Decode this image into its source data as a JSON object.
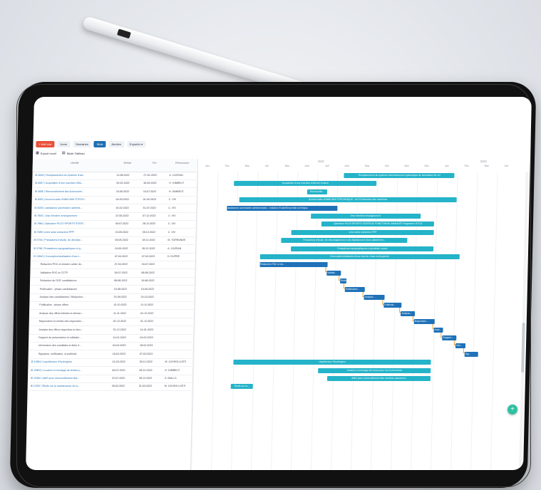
{
  "toolbar": {
    "add_label": "+ Add row",
    "views": [
      {
        "label": "Jours",
        "active": false
      },
      {
        "label": "Semaines",
        "active": false
      },
      {
        "label": "Mois",
        "active": true
      },
      {
        "label": "Années",
        "active": false
      }
    ],
    "export_menu": "Exporter ▾",
    "export_excel": "Export excel",
    "fullscreen": "Mode Tableau"
  },
  "columns": {
    "label": "Libellé",
    "start": "Début",
    "end": "Fin",
    "resource": "Ressource"
  },
  "timeline": {
    "years": [
      {
        "label": "2022"
      },
      {
        "label": "2023"
      }
    ],
    "months": [
      "Jan",
      "Fév",
      "Mar",
      "Avr",
      "Mai",
      "Juin",
      "Juil",
      "Aoû",
      "Sep",
      "Oct",
      "Nov",
      "Déc",
      "Jan",
      "Fév",
      "Mar",
      "Avr"
    ]
  },
  "rows": [
    {
      "label": "⊞ 0045 | Remplacement du système d'act...",
      "start": "11-08-2022",
      "end": "27-01-2023",
      "res": "A. CASSAN",
      "type": "parent"
    },
    {
      "label": "⊞ 0057 | Acquisition d'une machine d'éle...",
      "start": "26-02-2022",
      "end": "30-09-2022",
      "res": "H. GIMBEUT",
      "type": "parent"
    },
    {
      "label": "⊞ 0056 | Renouvellement des licences/m...",
      "start": "16-06-2022",
      "end": "16-07-2022",
      "res": "H. GIMBEUT",
      "type": "parent"
    },
    {
      "label": "⊞ 0053 | Accord-cadre d'AMO MULTITECH...",
      "start": "04-03-2022",
      "end": "01-02-2023",
      "res": "C. VIV",
      "type": "parent"
    },
    {
      "label": "⊞ 0033 | assistance automation adminis...",
      "start": "16-02-2022",
      "end": "31-07-2022",
      "res": "C. VIV",
      "type": "parent"
    },
    {
      "label": "⊞ 7926 | Jose fonction enseignement",
      "start": "22-06-2022",
      "end": "07-12-2022",
      "res": "C. VIV",
      "type": "parent"
    },
    {
      "label": "⊞ 7984 | Opération PCC3 SPORTS STATE...",
      "start": "09-07-2022",
      "end": "28-12-2022",
      "res": "C. VIV",
      "type": "parent"
    },
    {
      "label": "⊞ 7089 | zone solar extraction PPP",
      "start": "24-05-2022",
      "end": "28-12-2022",
      "res": "C. VIV",
      "type": "parent"
    },
    {
      "label": "⊞ 5794 | Prestations d'étude, de dévelop...",
      "start": "09-05-2022",
      "end": "18-11-2022",
      "res": "M. TORRANDE",
      "type": "parent"
    },
    {
      "label": "⊞ 5798 | Prestations topographiques et g...",
      "start": "24-05-2022",
      "end": "28-12-2022",
      "res": "A. CASSAN",
      "type": "parent"
    },
    {
      "label": "⊟ 12843 | Conception/réalisation d'une t...",
      "start": "07-04-2022",
      "end": "07-02-2023",
      "res": "H. DUPRE",
      "type": "parent"
    },
    {
      "label": "Rédaction PDC et dossier cahier de...",
      "start": "07-04-2022",
      "end": "18-07-2022",
      "res": "",
      "type": "child"
    },
    {
      "label": "Validation PDC et CCTP",
      "start": "18-07-2022",
      "end": "08-08-2022",
      "res": "",
      "type": "child"
    },
    {
      "label": "Rédaction du DCE candidatures",
      "start": "08-08-2022",
      "end": "16-08-2022",
      "res": "",
      "type": "child"
    },
    {
      "label": "Publication - phase candidatures",
      "start": "16-08-2022",
      "end": "15-09-2022",
      "res": "",
      "type": "child"
    },
    {
      "label": "Analyse des candidatures / Rédaction...",
      "start": "15-09-2022",
      "end": "15-10-2022",
      "res": "",
      "type": "child"
    },
    {
      "label": "Publication - phase offres",
      "start": "15-10-2022",
      "end": "11-11-2022",
      "res": "",
      "type": "child"
    },
    {
      "label": "Analyse des offres initiales et deman...",
      "start": "11-11-2022",
      "end": "01-12-2022",
      "res": "",
      "type": "child"
    },
    {
      "label": "Négociation et remise des négociatio...",
      "start": "01-12-2022",
      "end": "31-12-2022",
      "res": "",
      "type": "child"
    },
    {
      "label": "Analyse des offres négociées et deci...",
      "start": "31-12-2022",
      "end": "14-01-2023",
      "res": "",
      "type": "child"
    },
    {
      "label": "Rapport de présentation et validatio...",
      "start": "14-01-2023",
      "end": "04-02-2023",
      "res": "",
      "type": "child"
    },
    {
      "label": "Information des candidats et délai d...",
      "start": "04-02-2023",
      "end": "18-02-2023",
      "res": "",
      "type": "child"
    },
    {
      "label": "Signature, notification, et publicité",
      "start": "18-02-2023",
      "end": "07-03-2023",
      "res": "",
      "type": "child"
    },
    {
      "label": "⊞ 12844 | Liquéfacteur d'hydrogène",
      "start": "01-03-2022",
      "end": "28-12-2022",
      "res": "M. CAYROU-OSTI",
      "type": "parent"
    },
    {
      "label": "⊞ 12853 | Location et montage de tentes p...",
      "start": "09-07-2022",
      "end": "28-12-2022",
      "res": "H. GIMBEUT",
      "type": "parent"
    },
    {
      "label": "⊞ 12902 | AMO pour renouvellement des...",
      "start": "22-07-2022",
      "end": "28-12-2022",
      "res": "S. BIALLS",
      "type": "parent"
    },
    {
      "label": "⊞ 12937 | Étude sur la maintenance de la...",
      "start": "28-02-2022",
      "end": "31-03-2022",
      "res": "M. CAYROU-OSTI",
      "type": "parent"
    }
  ],
  "bars": [
    {
      "label": "Remplacement du système d'actionnement hydraulique du simulateur de vol",
      "color": "teal"
    },
    {
      "label": "Acquisition d'une machine d'électro érosion",
      "color": "teal"
    },
    {
      "label": "Renouvella...",
      "color": "teal"
    },
    {
      "label": "Accord-cadre d'AMO MULTITECHNIQUE - lot 3 Relocation des machines",
      "color": "teal"
    },
    {
      "label": "assistance automation administrative - Initiative Etude/Ensemble technique",
      "color": "blue"
    },
    {
      "label": "Jose fonction enseignement",
      "color": "teal"
    },
    {
      "label": "Opération PCC3 SPORTS STATEGIC FONCTIONAL MANAGE Programme STCO",
      "color": "teal"
    },
    {
      "label": "zone solar extraction PPP",
      "color": "teal"
    },
    {
      "label": "Prestations d'étude, de développement et de déploiement d'une plateforme...",
      "color": "teal"
    },
    {
      "label": "Prestations topographiques et géodésie export",
      "color": "teal"
    },
    {
      "label": "Conception/réalisation d'une tour de chute multi-gravité",
      "color": "teal"
    },
    {
      "label": "Rédaction PDC et do...",
      "color": "blue"
    },
    {
      "label": "Validat...",
      "color": "blue"
    },
    {
      "label": "Rédac...",
      "color": "blue"
    },
    {
      "label": "Publication...",
      "color": "blue"
    },
    {
      "label": "Analyse ...",
      "color": "blue"
    },
    {
      "label": "Publicati...",
      "color": "blue"
    },
    {
      "label": "Analyse...",
      "color": "blue"
    },
    {
      "label": "Négociatio...",
      "color": "blue"
    },
    {
      "label": "Anal...",
      "color": "blue"
    },
    {
      "label": "Rapport...",
      "color": "blue"
    },
    {
      "label": "Info...",
      "color": "blue"
    },
    {
      "label": "Sig...",
      "color": "blue"
    },
    {
      "label": "Liquéfacteur d'hydrogène",
      "color": "teal"
    },
    {
      "label": "location et montage de tentes pour les événements",
      "color": "teal"
    },
    {
      "label": "AMO pour renouvellement des marchés assurance",
      "color": "teal"
    },
    {
      "label": "Etude sur la...",
      "color": "teal"
    }
  ],
  "fab_icon": "plus-icon"
}
